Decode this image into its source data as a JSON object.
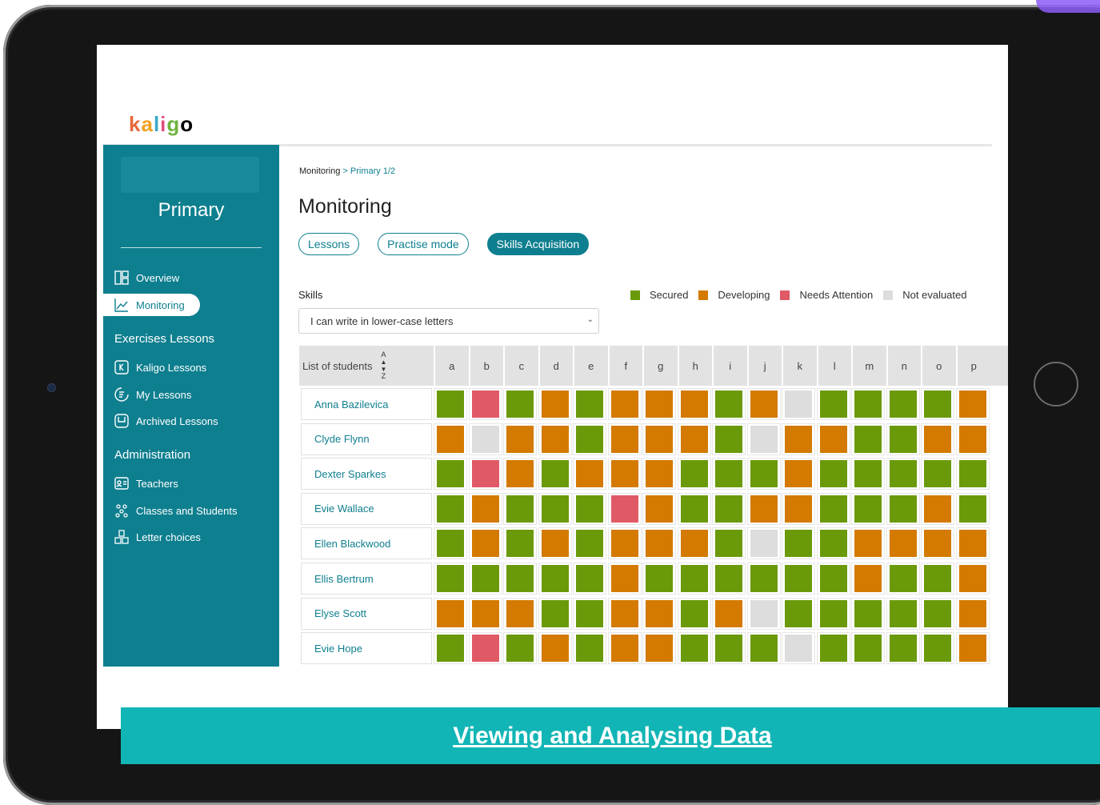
{
  "app": {
    "logo_text": "kaligo"
  },
  "sidebar": {
    "class_name": "Primary",
    "items": [
      {
        "label": "Overview",
        "icon": "layout-icon"
      },
      {
        "label": "Monitoring",
        "icon": "chart-line-icon",
        "active": true
      }
    ],
    "sections": [
      {
        "title": "Exercises Lessons",
        "items": [
          {
            "label": "Kaligo Lessons",
            "icon": "kaligo-k-icon"
          },
          {
            "label": "My Lessons",
            "icon": "my-lessons-icon"
          },
          {
            "label": "Archived Lessons",
            "icon": "archive-icon"
          }
        ]
      },
      {
        "title": "Administration",
        "items": [
          {
            "label": "Teachers",
            "icon": "id-card-icon"
          },
          {
            "label": "Classes and Students",
            "icon": "group-icon"
          },
          {
            "label": "Letter choices",
            "icon": "letters-icon"
          }
        ]
      }
    ]
  },
  "breadcrumb": {
    "root": "Monitoring",
    "sep": ">",
    "current": "Primary 1/2"
  },
  "page": {
    "title": "Monitoring"
  },
  "tabs": [
    {
      "label": "Lessons",
      "active": false
    },
    {
      "label": "Practise mode",
      "active": false
    },
    {
      "label": "Skills Acquisition",
      "active": true
    }
  ],
  "skills": {
    "label": "Skills",
    "selected": "I can write in lower-case letters"
  },
  "legend": [
    {
      "key": "S",
      "label": "Secured",
      "color": "#6a9a0a"
    },
    {
      "key": "D",
      "label": "Developing",
      "color": "#d47a00"
    },
    {
      "key": "N",
      "label": "Needs Attention",
      "color": "#e05a66"
    },
    {
      "key": "X",
      "label": "Not evaluated",
      "color": "#dddddd"
    }
  ],
  "table": {
    "students_header": "List of students",
    "sort_top": "A",
    "sort_bottom": "Z",
    "columns": [
      "a",
      "b",
      "c",
      "d",
      "e",
      "f",
      "g",
      "h",
      "i",
      "j",
      "k",
      "l",
      "m",
      "n",
      "o",
      "p"
    ],
    "rows": [
      {
        "name": "Anna Bazilevica",
        "status": "SNSDSDDDSDXSSSSD"
      },
      {
        "name": "Clyde Flynn",
        "status": "DXDDSDDDSXDDSSDD"
      },
      {
        "name": "Dexter Sparkes",
        "status": "SNDSDDDSSSDSSSSS"
      },
      {
        "name": "Evie Wallace",
        "status": "SDSSSNDSSDDSSSDS"
      },
      {
        "name": "Ellen Blackwood",
        "status": "SDSDSDDDSXSSDDDD"
      },
      {
        "name": "Ellis Bertrum",
        "status": "SSSSSDSSSSSSDSSD"
      },
      {
        "name": "Elyse Scott",
        "status": "DDDSSDDSDXSSSSSD"
      },
      {
        "name": "Evie Hope",
        "status": "SNSDSDDSSSXSSSSD"
      }
    ]
  },
  "banner": {
    "label": "Viewing and Analysing Data"
  }
}
